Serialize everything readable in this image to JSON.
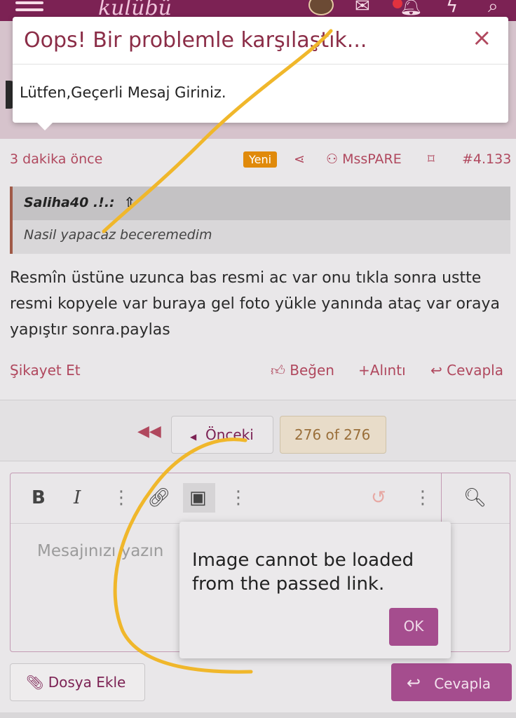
{
  "header": {
    "logo_text": "kulübü",
    "icons": [
      "menu-icon",
      "mail-icon",
      "bell-icon",
      "lightning-icon",
      "search-icon"
    ]
  },
  "error_modal": {
    "title": "Oops! Bir problemle karşılaştık...",
    "close": "×",
    "message": "Lütfen,Geçerli Mesaj Giriniz."
  },
  "post": {
    "time": "3 dakika önce",
    "new_badge": "Yeni",
    "author": "MssPARE",
    "post_number": "#4.133",
    "quote": {
      "author": "Saliha40 .!.:",
      "text": "Nasil yapacaz beceremedim"
    },
    "body": "Resmîn üstüne uzunca bas resmi ac var onu tıkla sonra ustte resmi kopyele var buraya gel foto yükle yanında ataç var oraya yapıştır sonra.paylas",
    "actions": {
      "report": "Şikayet Et",
      "like": "Beğen",
      "quote": "Alıntı",
      "reply": "Cevapla"
    }
  },
  "pagination": {
    "prev_label": "Önceki",
    "pages": "276 of 276"
  },
  "editor": {
    "placeholder": "Mesajınızı yazın",
    "toolbar": {
      "bold": "B",
      "italic": "I"
    }
  },
  "image_dialog": {
    "message": "Image cannot be loaded from the passed link.",
    "ok": "OK"
  },
  "footer_buttons": {
    "attach": "Dosya Ekle",
    "reply": "Cevapla"
  },
  "colors": {
    "brand": "#7c2254",
    "accent": "#b0485e",
    "button": "#a54d8e",
    "new_badge": "#e08a0b",
    "scribble": "#f0b72b"
  }
}
